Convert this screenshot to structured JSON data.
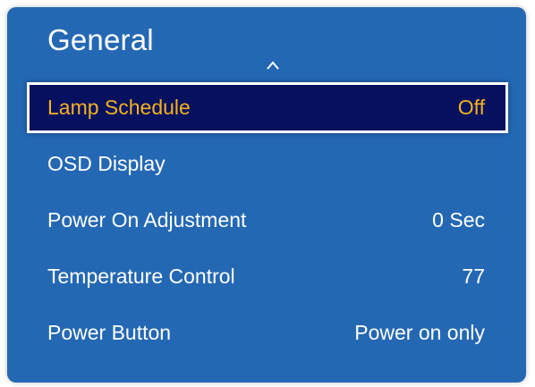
{
  "menu": {
    "title": "General",
    "scroll_up_icon": "chevron-up-icon",
    "items": [
      {
        "label": "Lamp Schedule",
        "value": "Off",
        "selected": true
      },
      {
        "label": "OSD Display",
        "value": "",
        "selected": false
      },
      {
        "label": "Power On Adjustment",
        "value": "0 Sec",
        "selected": false
      },
      {
        "label": "Temperature Control",
        "value": "77",
        "selected": false
      },
      {
        "label": "Power Button",
        "value": "Power on only",
        "selected": false
      }
    ]
  },
  "colors": {
    "panel_background": "#2468b4",
    "selected_background": "#05105f",
    "selected_text": "#f5b21f",
    "text": "#ffffff"
  }
}
